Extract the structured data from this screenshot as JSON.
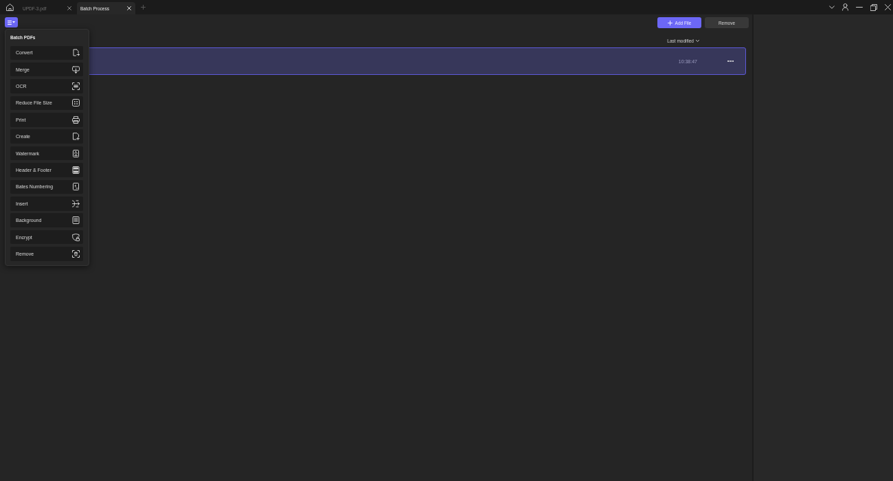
{
  "title_bar": {
    "tabs": [
      {
        "label": "UPDF-3.pdf",
        "selected": false
      },
      {
        "label": "Batch Process",
        "selected": true
      }
    ]
  },
  "toolbar": {
    "menu_button": {
      "expanded": true
    },
    "buttons": [
      {
        "label": "Add File",
        "kind": "primary"
      },
      {
        "label": "Remove",
        "kind": "secondary"
      }
    ]
  },
  "sort": {
    "label": "Last modified"
  },
  "files": [
    {
      "time": "10:38:47",
      "selected": true
    }
  ],
  "batch_menu": {
    "title": "Batch PDFs",
    "items": [
      "Convert",
      "Merge",
      "OCR",
      "Reduce File Size",
      "Print",
      "Create",
      "Watermark",
      "Header & Footer",
      "Bates Numbering",
      "Insert",
      "Background",
      "Encrypt",
      "Remove"
    ]
  }
}
